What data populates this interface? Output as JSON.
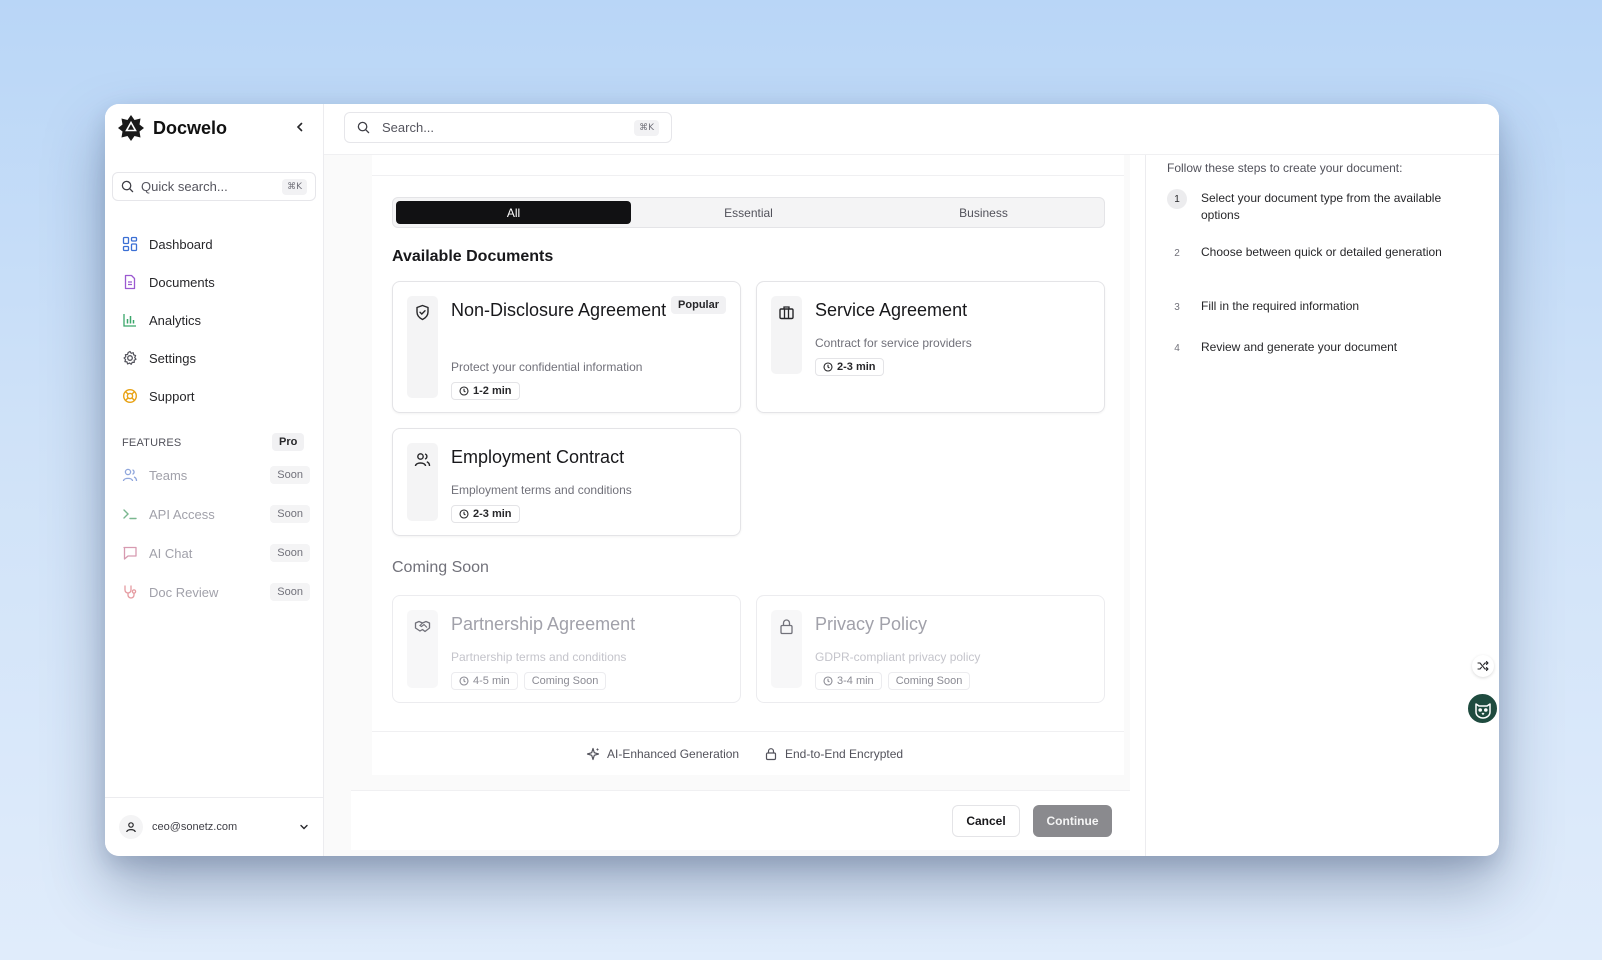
{
  "sidebar": {
    "brand": "Docwelo",
    "quick_search_placeholder": "Quick search...",
    "quick_search_kbd": "⌘K",
    "nav": [
      {
        "label": "Dashboard",
        "icon": "dashboard-icon"
      },
      {
        "label": "Documents",
        "icon": "document-icon"
      },
      {
        "label": "Analytics",
        "icon": "bar-chart-icon"
      },
      {
        "label": "Settings",
        "icon": "gear-icon"
      },
      {
        "label": "Support",
        "icon": "lifebuoy-icon"
      }
    ],
    "features_label": "FEATURES",
    "features_badge": "Pro",
    "features": [
      {
        "label": "Teams",
        "badge": "Soon",
        "icon": "users-icon"
      },
      {
        "label": "API Access",
        "badge": "Soon",
        "icon": "terminal-icon"
      },
      {
        "label": "AI Chat",
        "badge": "Soon",
        "icon": "chat-icon"
      },
      {
        "label": "Doc Review",
        "badge": "Soon",
        "icon": "stethoscope-icon"
      }
    ],
    "user_email": "ceo@sonetz.com"
  },
  "header": {
    "search_placeholder": "Search...",
    "search_kbd": "⌘K"
  },
  "main": {
    "tabs": [
      {
        "label": "All",
        "active": true
      },
      {
        "label": "Essential",
        "active": false
      },
      {
        "label": "Business",
        "active": false
      }
    ],
    "available_title": "Available Documents",
    "available": [
      {
        "title": "Non-Disclosure Agreement",
        "desc": "Protect your confidential information",
        "time": "1-2 min",
        "badge": "Popular",
        "icon": "shield-check-icon"
      },
      {
        "title": "Service Agreement",
        "desc": "Contract for service providers",
        "time": "2-3 min",
        "icon": "briefcase-icon"
      },
      {
        "title": "Employment Contract",
        "desc": "Employment terms and conditions",
        "time": "2-3 min",
        "icon": "users-icon"
      }
    ],
    "coming_title": "Coming Soon",
    "coming": [
      {
        "title": "Partnership Agreement",
        "desc": "Partnership terms and conditions",
        "time": "4-5 min",
        "status": "Coming Soon",
        "icon": "handshake-icon"
      },
      {
        "title": "Privacy Policy",
        "desc": "GDPR-compliant privacy policy",
        "time": "3-4 min",
        "status": "Coming Soon",
        "icon": "lock-icon"
      }
    ],
    "trust": [
      {
        "label": "AI-Enhanced Generation",
        "icon": "sparkles-icon"
      },
      {
        "label": "End-to-End Encrypted",
        "icon": "lock-icon"
      }
    ],
    "cancel_label": "Cancel",
    "continue_label": "Continue"
  },
  "guide": {
    "intro": "Follow these steps to create your document:",
    "steps": [
      {
        "num": "1",
        "text": "Select your document type from the available options"
      },
      {
        "num": "2",
        "text": "Choose between quick or detailed generation"
      },
      {
        "num": "3",
        "text": "Fill in the required information"
      },
      {
        "num": "4",
        "text": "Review and generate your document"
      }
    ]
  },
  "colors": {
    "accent": "#111113",
    "notification_dot": "#3b82f6",
    "owl_bg": "#1f4b3f"
  }
}
